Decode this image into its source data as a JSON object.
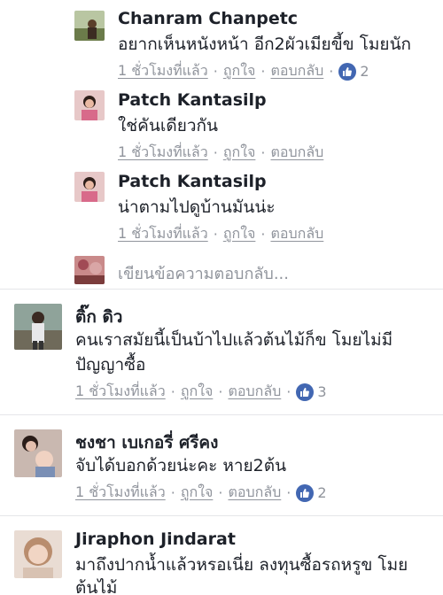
{
  "replies": [
    {
      "name": "Chanram Chanpetc",
      "text": "อยากเห็นหนังหน้า อีก2ผัวเมียขี้ข โมยนัก",
      "time": "1 ชั่วโมงที่แล้ว",
      "like": "ถูกใจ",
      "reply": "ตอบกลับ",
      "likes": "2"
    },
    {
      "name": "Patch Kantasilp",
      "text": "ใช่คันเดียวกัน",
      "time": "1 ชั่วโมงที่แล้ว",
      "like": "ถูกใจ",
      "reply": "ตอบกลับ"
    },
    {
      "name": "Patch Kantasilp",
      "text": "น่าตามไปดูบ้านมันน่ะ",
      "time": "1 ชั่วโมงที่แล้ว",
      "like": "ถูกใจ",
      "reply": "ตอบกลับ"
    }
  ],
  "reply_placeholder": "เขียนข้อความตอบกลับ...",
  "comments": [
    {
      "name": "ติ๊ก ดิว",
      "text_line1": "คนเราสมัยนี้เป็นบ้าไปแล้วต้นไม้ก็ข โมยไม่มี",
      "text_line2": "ปัญญาซื้อ",
      "time": "1 ชั่วโมงที่แล้ว",
      "like": "ถูกใจ",
      "reply": "ตอบกลับ",
      "likes": "3"
    },
    {
      "name": "ชงชา เบเกอรี่ ศรีคง",
      "text_line1": "จับได้บอกด้วยน่ะคะ หาย2ต้น",
      "time": "1 ชั่วโมงที่แล้ว",
      "like": "ถูกใจ",
      "reply": "ตอบกลับ",
      "likes": "2"
    },
    {
      "name": "Jiraphon Jindarat",
      "text_line1": "มาถึงปากน้ำแล้วหรอเนี่ย ลงทุนซื้อรถหรูข โมย",
      "text_line2": "ต้นไม้"
    }
  ],
  "colors": {
    "like_blue": "#4267b2",
    "meta_gray": "#90949c",
    "separator": "#e5e6e9"
  }
}
